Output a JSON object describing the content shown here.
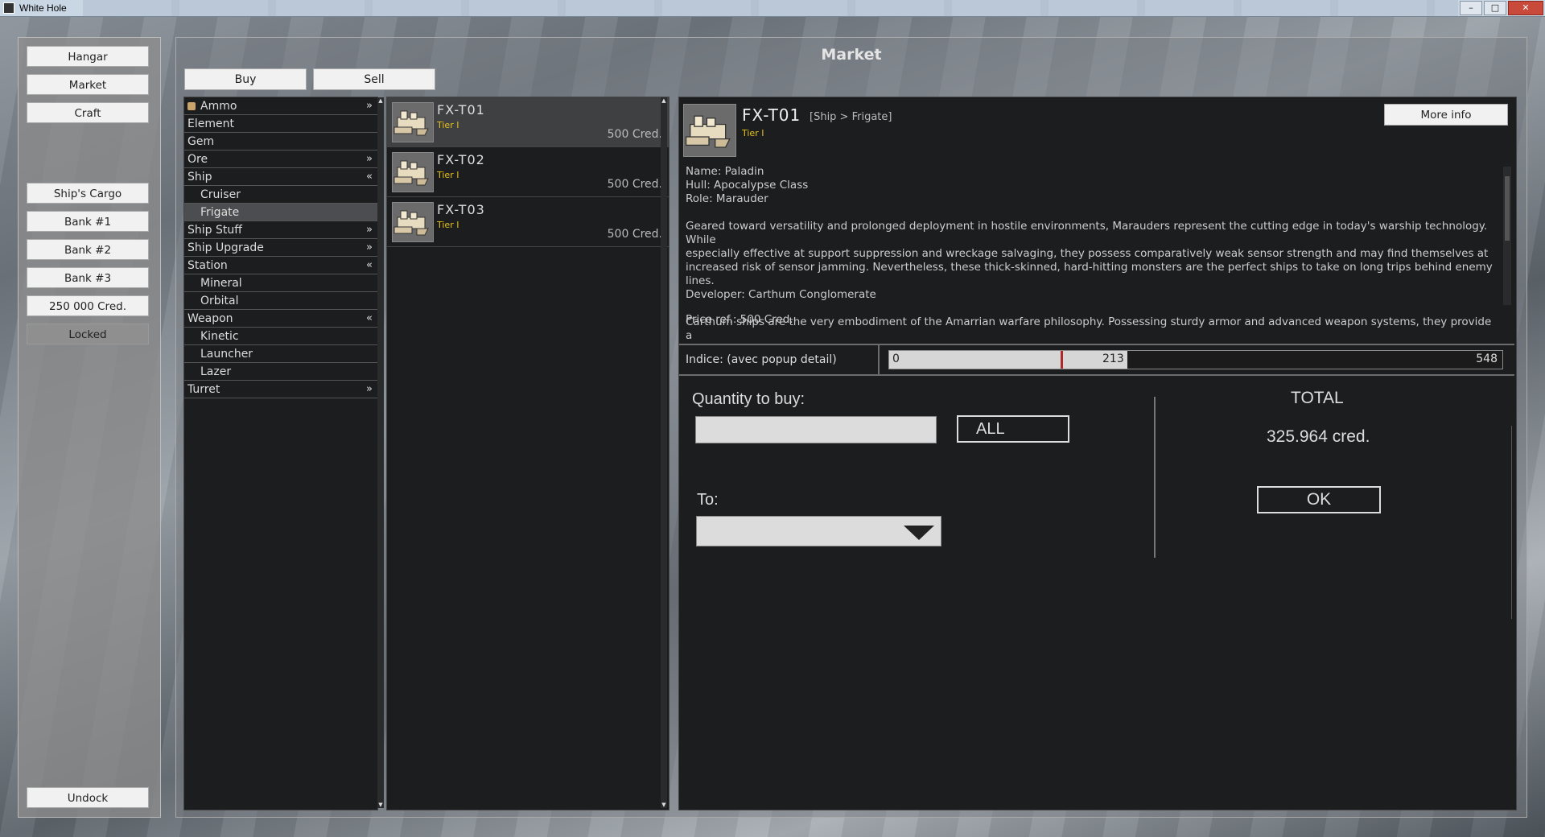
{
  "window": {
    "title": "White Hole",
    "controls": [
      "–",
      "□",
      "✕"
    ]
  },
  "sidebar": {
    "buttons": [
      {
        "label": "Hangar"
      },
      {
        "label": "Market"
      },
      {
        "label": "Craft"
      },
      {
        "label": "Ship's Cargo"
      },
      {
        "label": "Bank #1"
      },
      {
        "label": "Bank #2"
      },
      {
        "label": "Bank #3"
      },
      {
        "label": "250 000 Cred."
      },
      {
        "label": "Locked"
      }
    ],
    "undock": "Undock"
  },
  "market": {
    "title": "Market",
    "tabs": [
      {
        "label": "Buy"
      },
      {
        "label": "Sell"
      }
    ]
  },
  "categories": [
    {
      "label": "Ammo",
      "chevron": "»"
    },
    {
      "label": "Element",
      "chevron": ""
    },
    {
      "label": "Gem",
      "chevron": ""
    },
    {
      "label": "Ore",
      "chevron": "»"
    },
    {
      "label": "Ship",
      "chevron": "«"
    },
    {
      "label": "Cruiser",
      "chevron": ""
    },
    {
      "label": "Frigate",
      "chevron": ""
    },
    {
      "label": "Ship Stuff",
      "chevron": "»"
    },
    {
      "label": "Ship Upgrade",
      "chevron": "»"
    },
    {
      "label": "Station",
      "chevron": "«"
    },
    {
      "label": "Mineral",
      "chevron": ""
    },
    {
      "label": "Orbital",
      "chevron": ""
    },
    {
      "label": "Weapon",
      "chevron": "«"
    },
    {
      "label": "Kinetic",
      "chevron": ""
    },
    {
      "label": "Launcher",
      "chevron": ""
    },
    {
      "label": "Lazer",
      "chevron": ""
    },
    {
      "label": "Turret",
      "chevron": "»"
    }
  ],
  "items": [
    {
      "name": "FX-T01",
      "tier": "Tier I",
      "price": "500 Cred."
    },
    {
      "name": "FX-T02",
      "tier": "Tier I",
      "price": "500 Cred."
    },
    {
      "name": "FX-T03",
      "tier": "Tier I",
      "price": "500 Cred."
    }
  ],
  "detail": {
    "name": "FX-T01",
    "path": "[Ship > Frigate]",
    "tier": "Tier I",
    "more_info": "More info",
    "specs": [
      "Name: Paladin",
      "Hull: Apocalypse Class",
      "Role: Marauder"
    ],
    "description": [
      "Geared toward versatility and prolonged deployment in hostile environments, Marauders represent the cutting edge in today's warship technology. While",
      "especially effective at support suppression and wreckage salvaging, they possess comparatively weak sensor strength and may find themselves at",
      "increased risk of sensor jamming. Nevertheless, these thick-skinned, hard-hitting monsters are the perfect ships to take on long trips behind enemy lines.",
      "Developer: Carthum Conglomerate"
    ],
    "description2": "Carthum ships are the very embodiment of the Amarrian warfare philosophy. Possessing sturdy armor and advanced weapon systems, they provide a",
    "price_ref": "Price ref.:   500 Cred."
  },
  "indice": {
    "label": "Indice: (avec popup detail)",
    "min_label": "0",
    "value_label": "213",
    "max_label": "548",
    "marker_value": 153,
    "value": 213,
    "max": 548
  },
  "purchase": {
    "quantity_label": "Quantity to buy:",
    "quantity_value": "",
    "all_label": "ALL",
    "to_label": "To:",
    "to_value": "",
    "total_label": "TOTAL",
    "total_value": "325.964 cred.",
    "ok_label": "OK"
  }
}
